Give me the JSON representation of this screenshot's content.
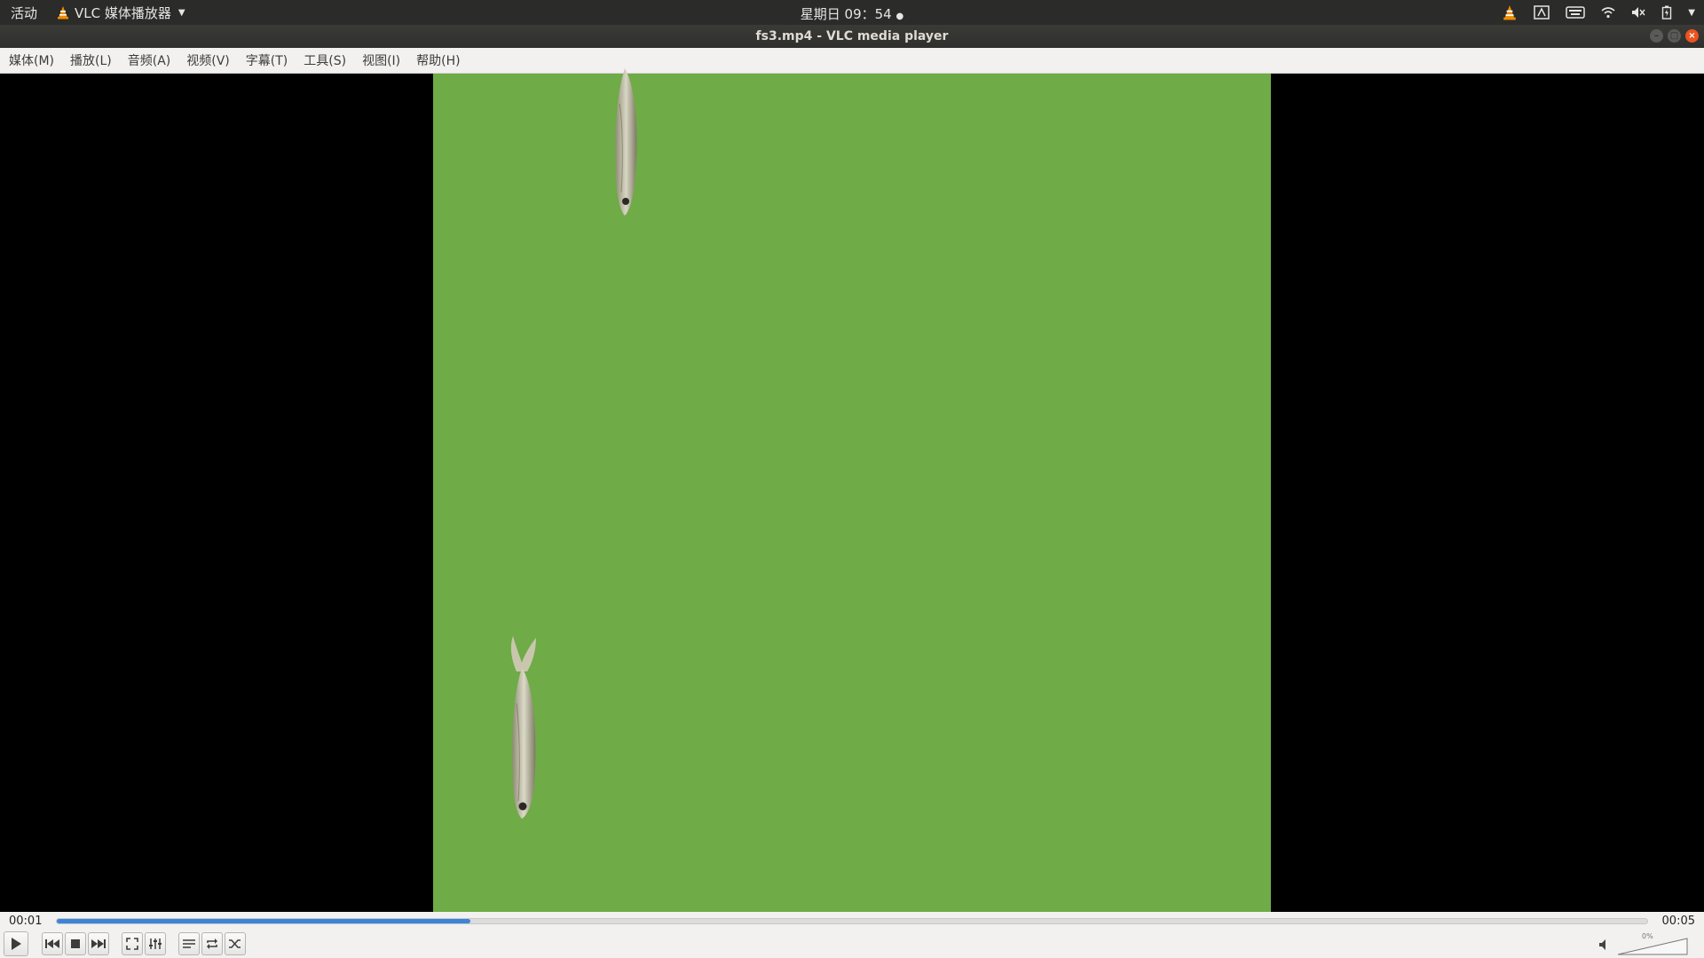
{
  "topbar": {
    "activities": "活动",
    "app_name": "VLC 媒体播放器",
    "clock": "星期日 09：54",
    "icons": [
      "vlc-tray-icon",
      "accessibility-icon",
      "keyboard-icon",
      "wifi-icon",
      "volume-muted-icon",
      "battery-icon",
      "system-menu-caret-icon"
    ]
  },
  "window": {
    "title": "fs3.mp4 - VLC media player"
  },
  "menu": [
    {
      "label": "媒体(M)"
    },
    {
      "label": "播放(L)"
    },
    {
      "label": "音频(A)"
    },
    {
      "label": "视频(V)"
    },
    {
      "label": "字幕(T)"
    },
    {
      "label": "工具(S)"
    },
    {
      "label": "视图(I)"
    },
    {
      "label": "帮助(H)"
    }
  ],
  "playback": {
    "elapsed": "00:01",
    "total": "00:05",
    "progress_percent": 26
  },
  "volume": {
    "percent_label": "0%",
    "level_percent": 0
  },
  "colors": {
    "video_background": "#6fab47",
    "seek_fill": "#3d84d6",
    "close_button": "#e9541f"
  }
}
